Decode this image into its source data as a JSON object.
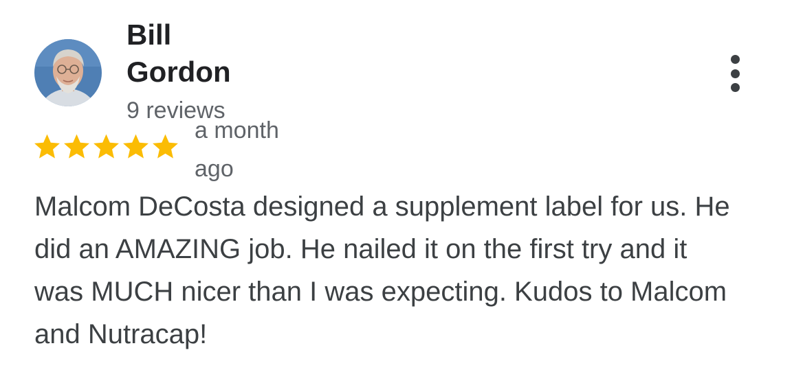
{
  "reviewer": {
    "name": "Bill Gordon",
    "review_count": "9 reviews",
    "avatar_icon": "person-photo"
  },
  "review": {
    "rating": 5,
    "rating_max": 5,
    "star_color": "#FBBC04",
    "date": "a month ago",
    "text": "Malcom DeCosta designed a supplement label for us. He did an AMAZING job. He nailed it on the first try and it was MUCH nicer than I was expecting. Kudos to Malcom and Nutracap!"
  },
  "menu": {
    "icon": "more-vert-icon"
  },
  "colors": {
    "name_text": "#202124",
    "secondary_text": "#5f6368",
    "body_text": "#3c4043"
  }
}
